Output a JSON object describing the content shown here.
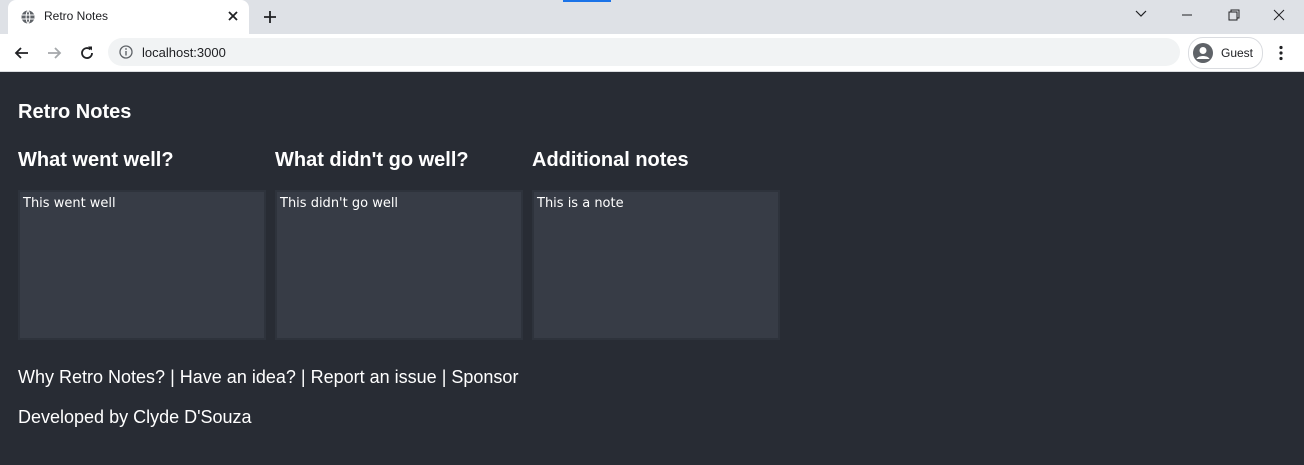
{
  "browser": {
    "tab_title": "Retro Notes",
    "url": "localhost:3000",
    "profile_label": "Guest"
  },
  "page": {
    "app_title": "Retro Notes",
    "columns": [
      {
        "heading": "What went well?",
        "note": "This went well"
      },
      {
        "heading": "What didn't go well?",
        "note": "This didn't go well"
      },
      {
        "heading": "Additional notes",
        "note": "This is a note"
      }
    ],
    "footer": {
      "links": [
        "Why Retro Notes?",
        "Have an idea?",
        "Report an issue",
        "Sponsor"
      ],
      "separator": "|",
      "credit": "Developed by Clyde D'Souza"
    }
  },
  "colors": {
    "background": "#282c34",
    "note_background": "#373c46",
    "text": "#ffffff"
  },
  "icons": [
    "globe-icon",
    "close-icon",
    "plus-icon",
    "chevron-down-icon",
    "minimize-icon",
    "restore-icon",
    "window-close-icon",
    "back-arrow-icon",
    "forward-arrow-icon",
    "reload-icon",
    "info-icon",
    "account-icon",
    "more-vert-icon"
  ]
}
